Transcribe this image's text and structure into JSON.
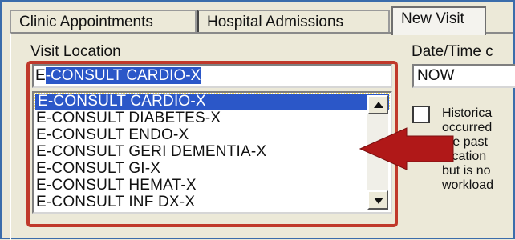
{
  "tabs": [
    {
      "label": "Clinic Appointments",
      "active": false
    },
    {
      "label": "Hospital Admissions",
      "active": false
    },
    {
      "label": "New Visit",
      "active": true
    }
  ],
  "visit_location": {
    "label": "Visit Location",
    "input_value_prefix": "E",
    "input_value_selected": "-CONSULT CARDIO-X",
    "options": [
      "E-CONSULT CARDIO-X",
      "E-CONSULT DIABETES-X",
      "E-CONSULT ENDO-X",
      "E-CONSULT GERI DEMENTIA-X",
      "E-CONSULT GI-X",
      "E-CONSULT HEMAT-X",
      "E-CONSULT INF DX-X"
    ],
    "selected_index": 0
  },
  "date_time": {
    "label": "Date/Time c",
    "value": "NOW"
  },
  "historical": {
    "checked": false,
    "lines": [
      "Historica",
      "occurred",
      "the past",
      "location",
      "but is no",
      "workload"
    ]
  },
  "colors": {
    "highlight_border": "#c0392b",
    "callout_arrow": "#b01818",
    "selection": "#2b57c8"
  }
}
